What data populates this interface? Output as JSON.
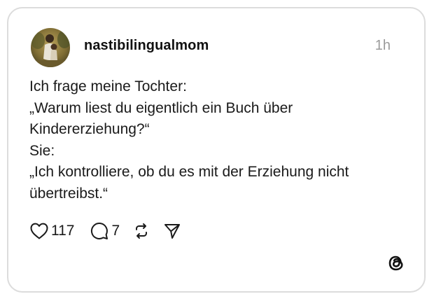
{
  "post": {
    "username": "nastibilingualmom",
    "timestamp": "1h",
    "lines": [
      "Ich frage meine Tochter:",
      "„Warum liest du eigentlich ein Buch über",
      "Kindererziehung?“",
      "Sie:",
      "„Ich kontrolliere, ob du es mit der Erziehung nicht",
      "übertreibst.“"
    ]
  },
  "actions": {
    "likes": "117",
    "replies": "7",
    "icons": [
      "heart-icon",
      "comment-icon",
      "repost-icon",
      "share-icon"
    ]
  },
  "brand": {
    "logo": "threads-logo-icon"
  },
  "colors": {
    "text": "#1a1a1a",
    "muted": "#9a9a9a",
    "border": "#dcdcdc"
  }
}
